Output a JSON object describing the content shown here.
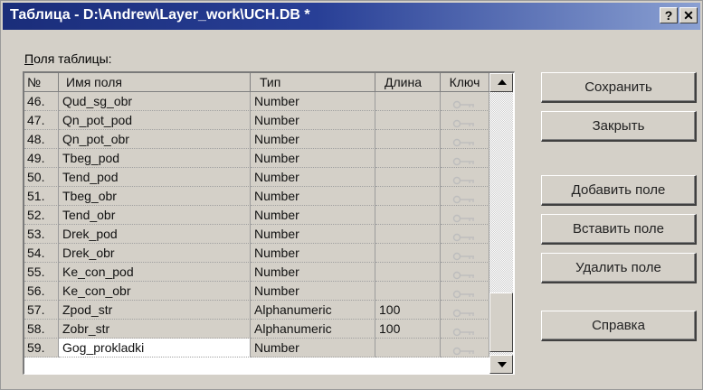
{
  "window": {
    "title": "Таблица - D:\\Andrew\\Layer_work\\UCH.DB *",
    "help_glyph": "?",
    "close_glyph": "✕"
  },
  "fields_label_underlined": "П",
  "fields_label_rest": "оля таблицы:",
  "columns": {
    "num": "№",
    "name": "Имя поля",
    "type": "Тип",
    "length": "Длина",
    "key": "Ключ"
  },
  "rows": [
    {
      "num": "46.",
      "name": "Qud_sg_obr",
      "type": "Number",
      "length": ""
    },
    {
      "num": "47.",
      "name": "Qn_pot_pod",
      "type": "Number",
      "length": ""
    },
    {
      "num": "48.",
      "name": "Qn_pot_obr",
      "type": "Number",
      "length": ""
    },
    {
      "num": "49.",
      "name": "Tbeg_pod",
      "type": "Number",
      "length": ""
    },
    {
      "num": "50.",
      "name": "Tend_pod",
      "type": "Number",
      "length": ""
    },
    {
      "num": "51.",
      "name": "Tbeg_obr",
      "type": "Number",
      "length": ""
    },
    {
      "num": "52.",
      "name": "Tend_obr",
      "type": "Number",
      "length": ""
    },
    {
      "num": "53.",
      "name": "Drek_pod",
      "type": "Number",
      "length": ""
    },
    {
      "num": "54.",
      "name": "Drek_obr",
      "type": "Number",
      "length": ""
    },
    {
      "num": "55.",
      "name": "Ke_con_pod",
      "type": "Number",
      "length": ""
    },
    {
      "num": "56.",
      "name": "Ke_con_obr",
      "type": "Number",
      "length": ""
    },
    {
      "num": "57.",
      "name": "Zpod_str",
      "type": "Alphanumeric",
      "length": "100"
    },
    {
      "num": "58.",
      "name": "Zobr_str",
      "type": "Alphanumeric",
      "length": "100"
    },
    {
      "num": "59.",
      "name": "Gog_prokladki",
      "type": "Number",
      "length": "",
      "selected": true
    }
  ],
  "buttons": {
    "save": "Сохранить",
    "close": "Закрыть",
    "add_field": "Добавить поле",
    "insert_field": "Вставить поле",
    "delete_field": "Удалить поле",
    "help": "Справка"
  },
  "colors": {
    "title_bar_start": "#1a2d7a",
    "title_bar_end": "#8aa0d2",
    "window_face": "#d4d0c8"
  },
  "icons": {
    "key": "key-icon",
    "scroll_up": "scroll-up-arrow-icon",
    "scroll_down": "scroll-down-arrow-icon"
  }
}
